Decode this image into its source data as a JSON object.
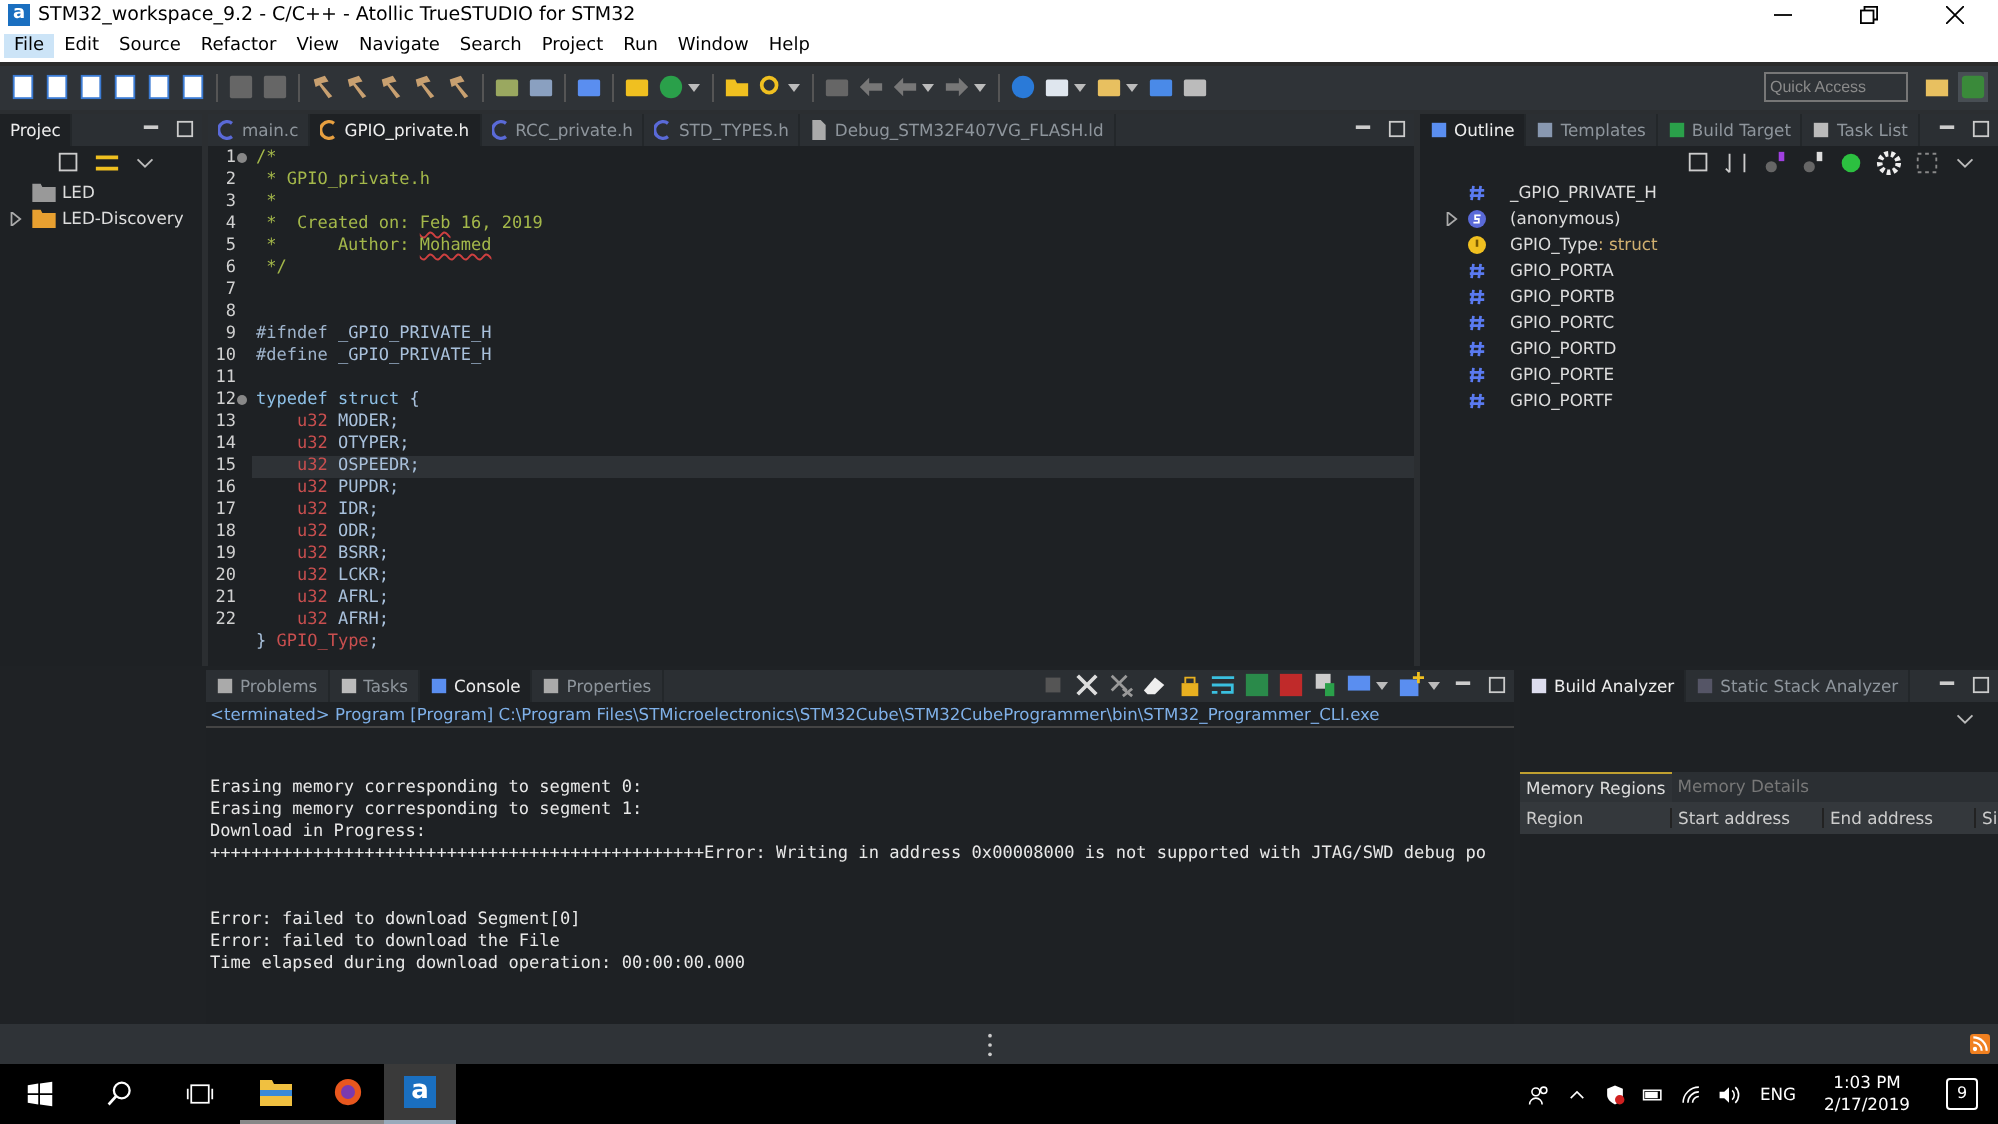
{
  "window": {
    "logo_letter": "a",
    "title": "STM32_workspace_9.2 - C/C++ - Atollic TrueSTUDIO for STM32"
  },
  "menu": [
    {
      "label": "File",
      "selected": true
    },
    {
      "label": "Edit",
      "selected": false
    },
    {
      "label": "Source",
      "selected": false
    },
    {
      "label": "Refactor",
      "selected": false
    },
    {
      "label": "View",
      "selected": false
    },
    {
      "label": "Navigate",
      "selected": false
    },
    {
      "label": "Search",
      "selected": false
    },
    {
      "label": "Project",
      "selected": false
    },
    {
      "label": "Run",
      "selected": false
    },
    {
      "label": "Window",
      "selected": false
    },
    {
      "label": "Help",
      "selected": false
    }
  ],
  "quick_access": {
    "placeholder": "Quick Access"
  },
  "project_explorer": {
    "tabs": [
      {
        "label": "Projec",
        "selected": true
      }
    ],
    "items": [
      {
        "label": "LED",
        "kind": "folder"
      },
      {
        "label": "LED-Discovery",
        "kind": "project",
        "expanded": false
      }
    ]
  },
  "editor": {
    "tabs": [
      {
        "label": "main.c",
        "kind": "c",
        "selected": false
      },
      {
        "label": "GPIO_private.h",
        "kind": "c",
        "selected": true
      },
      {
        "label": "RCC_private.h",
        "kind": "c",
        "selected": false
      },
      {
        "label": "STD_TYPES.h",
        "kind": "c",
        "selected": false
      },
      {
        "label": "Debug_STM32F407VG_FLASH.ld",
        "kind": "file",
        "selected": false
      }
    ],
    "lines": [
      {
        "number": "1",
        "fold": true,
        "current": false,
        "segments": [
          {
            "kind": "comment",
            "text": "/*"
          }
        ]
      },
      {
        "number": "2",
        "fold": false,
        "current": false,
        "segments": [
          {
            "kind": "comment",
            "text": " * GPIO_private.h"
          }
        ]
      },
      {
        "number": "3",
        "fold": false,
        "current": false,
        "segments": [
          {
            "kind": "comment",
            "text": " *"
          }
        ]
      },
      {
        "number": "4",
        "fold": false,
        "current": false,
        "segments": [
          {
            "kind": "comment",
            "text": " *  Created on: "
          },
          {
            "kind": "misspelled",
            "text": "Feb"
          },
          {
            "kind": "comment",
            "text": " 16, 2019"
          }
        ]
      },
      {
        "number": "5",
        "fold": false,
        "current": false,
        "segments": [
          {
            "kind": "comment",
            "text": " *      Author: "
          },
          {
            "kind": "misspelled",
            "text": "Mohamed"
          }
        ]
      },
      {
        "number": "6",
        "fold": false,
        "current": false,
        "segments": [
          {
            "kind": "comment",
            "text": " */"
          }
        ]
      },
      {
        "number": "7",
        "fold": false,
        "current": false
      },
      {
        "number": "8",
        "fold": false,
        "current": false
      },
      {
        "number": "9",
        "fold": false,
        "current": false,
        "segments": [
          {
            "kind": "preproc",
            "text": "#ifndef"
          },
          {
            "kind": "plain",
            "text": " _GPIO_PRIVATE_H"
          }
        ]
      },
      {
        "number": "10",
        "fold": false,
        "current": false,
        "segments": [
          {
            "kind": "preproc",
            "text": "#define"
          },
          {
            "kind": "plain",
            "text": " _GPIO_PRIVATE_H"
          }
        ]
      },
      {
        "number": "11",
        "fold": false,
        "current": false
      },
      {
        "number": "12",
        "fold": true,
        "current": false,
        "segments": [
          {
            "kind": "keyword",
            "text": "typedef"
          },
          {
            "kind": "keyword",
            "text": " struct"
          },
          {
            "kind": "plain",
            "text": " {"
          }
        ]
      },
      {
        "number": "13",
        "fold": false,
        "current": false,
        "segments": [
          {
            "kind": "type",
            "text": "    u32"
          },
          {
            "kind": "plain",
            "text": " MODER;"
          }
        ]
      },
      {
        "number": "14",
        "fold": false,
        "current": false,
        "segments": [
          {
            "kind": "type",
            "text": "    u32"
          },
          {
            "kind": "plain",
            "text": " OTYPER;"
          }
        ]
      },
      {
        "number": "15",
        "fold": false,
        "current": true,
        "segments": [
          {
            "kind": "type",
            "text": "    u32"
          },
          {
            "kind": "plain",
            "text": " OSPEEDR;"
          }
        ]
      },
      {
        "number": "16",
        "fold": false,
        "current": false,
        "segments": [
          {
            "kind": "type",
            "text": "    u32"
          },
          {
            "kind": "plain",
            "text": " PUPDR;"
          }
        ]
      },
      {
        "number": "17",
        "fold": false,
        "current": false,
        "segments": [
          {
            "kind": "type",
            "text": "    u32"
          },
          {
            "kind": "plain",
            "text": " IDR;"
          }
        ]
      },
      {
        "number": "18",
        "fold": false,
        "current": false,
        "segments": [
          {
            "kind": "type",
            "text": "    u32"
          },
          {
            "kind": "plain",
            "text": " ODR;"
          }
        ]
      },
      {
        "number": "19",
        "fold": false,
        "current": false,
        "segments": [
          {
            "kind": "type",
            "text": "    u32"
          },
          {
            "kind": "plain",
            "text": " BSRR;"
          }
        ]
      },
      {
        "number": "20",
        "fold": false,
        "current": false,
        "segments": [
          {
            "kind": "type",
            "text": "    u32"
          },
          {
            "kind": "plain",
            "text": " LCKR;"
          }
        ]
      },
      {
        "number": "21",
        "fold": false,
        "current": false,
        "segments": [
          {
            "kind": "type",
            "text": "    u32"
          },
          {
            "kind": "plain",
            "text": " AFRL;"
          }
        ]
      },
      {
        "number": "22",
        "fold": false,
        "current": false,
        "segments": [
          {
            "kind": "type",
            "text": "    u32"
          },
          {
            "kind": "plain",
            "text": " AFRH;"
          }
        ]
      },
      {
        "fold": false,
        "current": false,
        "segments": [
          {
            "kind": "plain",
            "text": "}"
          },
          {
            "kind": "type",
            "text": " GPIO_Type"
          },
          {
            "kind": "plain",
            "text": ";"
          }
        ]
      }
    ]
  },
  "outline": {
    "tabs": [
      {
        "label": "Outline",
        "kind": "outline",
        "selected": true
      },
      {
        "label": "Templates",
        "kind": "templates",
        "selected": false
      },
      {
        "label": "Build Target",
        "kind": "target",
        "selected": false
      },
      {
        "label": "Task List",
        "kind": "tasks",
        "selected": false
      }
    ],
    "items": [
      {
        "label": "_GPIO_PRIVATE_H",
        "kind": "macro"
      },
      {
        "label": "(anonymous)",
        "kind": "struct",
        "expanded": false
      },
      {
        "label": "GPIO_Type",
        "type": ": struct",
        "kind": "typedef"
      },
      {
        "label": "GPIO_PORTA",
        "kind": "macro"
      },
      {
        "label": "GPIO_PORTB",
        "kind": "macro"
      },
      {
        "label": "GPIO_PORTC",
        "kind": "macro"
      },
      {
        "label": "GPIO_PORTD",
        "kind": "macro"
      },
      {
        "label": "GPIO_PORTE",
        "kind": "macro"
      },
      {
        "label": "GPIO_PORTF",
        "kind": "macro"
      }
    ]
  },
  "console": {
    "tabs": [
      {
        "label": "Problems",
        "kind": "problems",
        "selected": false
      },
      {
        "label": "Tasks",
        "kind": "tasks",
        "selected": false
      },
      {
        "label": "Console",
        "kind": "console",
        "selected": true
      },
      {
        "label": "Properties",
        "kind": "properties",
        "selected": false
      }
    ],
    "process": "<terminated> Program [Program] C:\\Program Files\\STMicroelectronics\\STM32Cube\\STM32CubeProgrammer\\bin\\STM32_Programmer_CLI.exe",
    "lines": [
      {
        "kind": "blank"
      },
      {
        "kind": "blank"
      },
      {
        "kind": "output",
        "text": "Erasing memory corresponding to segment 0:"
      },
      {
        "kind": "output",
        "text": "Erasing memory corresponding to segment 1:"
      },
      {
        "kind": "output",
        "text": "Download in Progress:"
      },
      {
        "kind": "output",
        "text": "++++++++++++++++++++++++++++++++++++++++++++++++Error: Writing in address 0x00008000 is not supported with JTAG/SWD debug po"
      },
      {
        "kind": "blank"
      },
      {
        "kind": "blank"
      },
      {
        "kind": "output",
        "text": "Error: failed to download Segment[0]"
      },
      {
        "kind": "output",
        "text": "Error: failed to download the File"
      },
      {
        "kind": "output",
        "text": "Time elapsed during download operation: 00:00:00.000"
      }
    ]
  },
  "build_analyzer": {
    "tabs": [
      {
        "label": "Build Analyzer",
        "selected": true
      },
      {
        "label": "Static Stack Analyzer",
        "selected": false
      }
    ],
    "subtabs": [
      {
        "label": "Memory Regions",
        "selected": true
      },
      {
        "label": "Memory Details",
        "selected": false
      }
    ],
    "columns": [
      "Region",
      "Start address",
      "End address",
      "Si"
    ]
  },
  "taskbar": {
    "apps": [
      {
        "kind": "explorer",
        "selected": false
      },
      {
        "kind": "firefox",
        "selected": false
      },
      {
        "kind": "atollic",
        "selected": true
      }
    ],
    "logo_letter": "a",
    "language": "ENG",
    "time": "1:03 PM",
    "date": "2/17/2019",
    "notifications": "9"
  }
}
